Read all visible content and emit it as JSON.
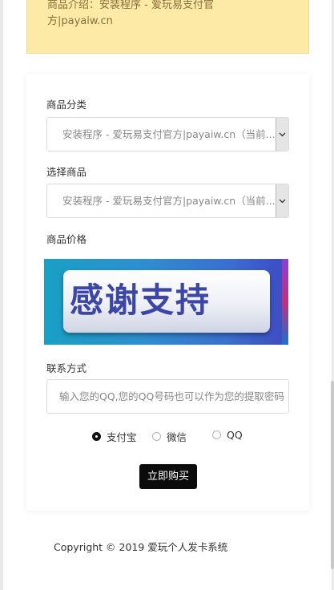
{
  "notice": {
    "line1": "商品介绍：安装程序 - 爱玩易支付官",
    "line2": "方|payaiw.cn",
    "bg_color": "#fdeaa7"
  },
  "form": {
    "category_label": "商品分类",
    "category_value": "安装程序 - 爱玩易支付官方|payaiw.cn（当前...",
    "product_label": "选择商品",
    "product_value": "安装程序 - 爱玩易支付官方|payaiw.cn（当前...",
    "price_label": "商品价格",
    "banner_text": "感谢支持",
    "contact_label": "联系方式",
    "contact_placeholder": "输入您的QQ,您的QQ号码也可以作为您的提取密码",
    "payment_options": [
      {
        "label": "支付宝",
        "checked": true
      },
      {
        "label": "微信",
        "checked": false
      },
      {
        "label": "QQ",
        "checked": false
      }
    ],
    "buy_label": "立即购买",
    "buy_color": "#0b0b0b"
  },
  "footer": {
    "copyright": "Copyright © 2019 爱玩个人发卡系统"
  },
  "icons": {
    "select_arrow": "chevron-down-icon",
    "radio": "radio-icon"
  }
}
